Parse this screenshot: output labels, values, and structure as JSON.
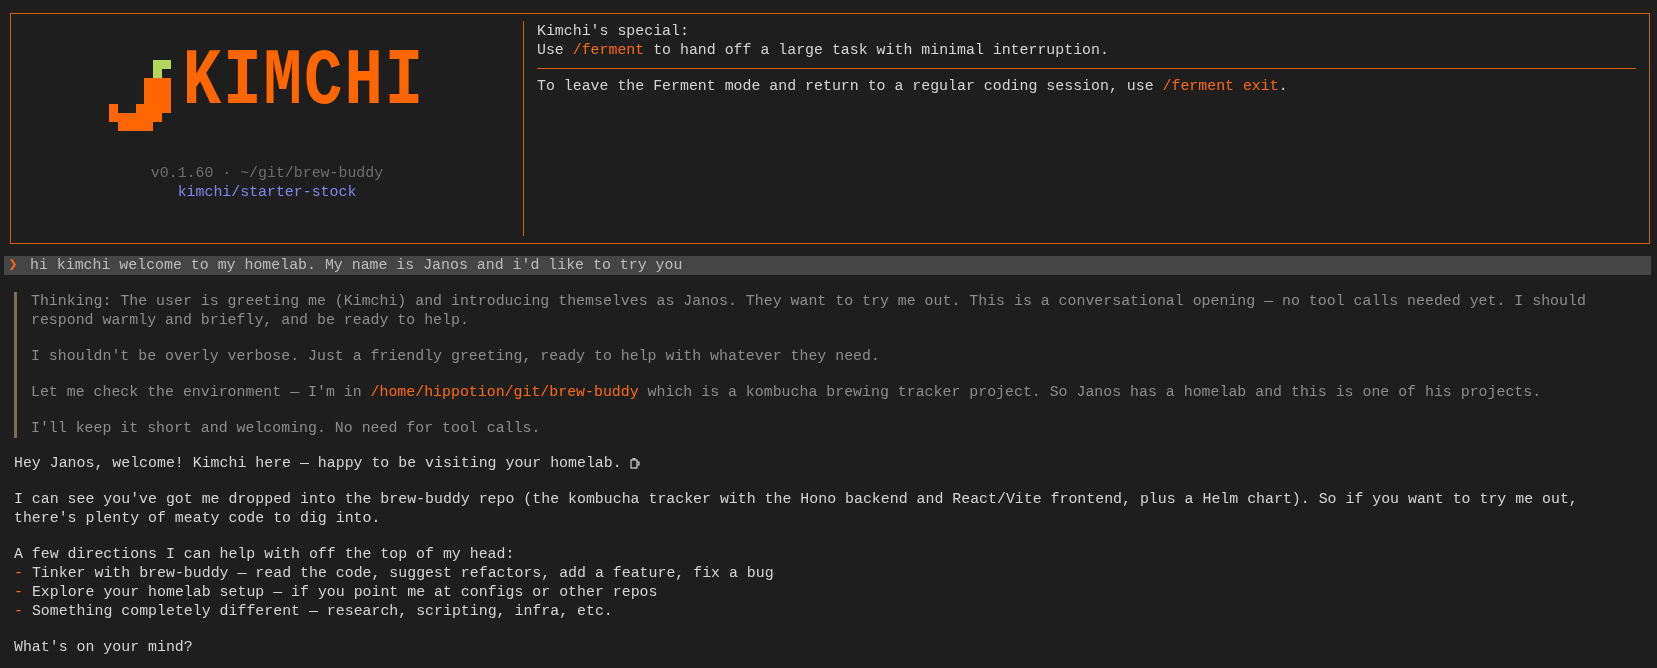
{
  "header": {
    "logo_text": "KIMCHI",
    "version_line": "v0.1.60 · ~/git/brew-buddy",
    "model": "kimchi/starter-stock",
    "special_title": "Kimchi's special:",
    "special_line": [
      {
        "kind": "plain",
        "text": "Use "
      },
      {
        "kind": "command",
        "text": "/ferment"
      },
      {
        "kind": "plain",
        "text": " to hand off a large task with minimal interruption."
      }
    ],
    "exit_line": [
      {
        "kind": "plain",
        "text": "To leave the Ferment mode and return to a regular coding session, use "
      },
      {
        "kind": "command",
        "text": "/ferment exit"
      },
      {
        "kind": "plain",
        "text": "."
      }
    ]
  },
  "prompt": {
    "marker": "❯",
    "text": "hi kimchi welcome to my homelab. My name is Janos and i'd like to try you"
  },
  "thinking": [
    [
      {
        "kind": "plain",
        "text": "Thinking: The user is greeting me (Kimchi) and introducing themselves as Janos. They want to try me out. This is a conversational opening — no tool calls needed yet. I should respond warmly and briefly, and be ready to help."
      }
    ],
    [
      {
        "kind": "plain",
        "text": "I shouldn't be overly verbose. Just a friendly greeting, ready to help with whatever they need."
      }
    ],
    [
      {
        "kind": "plain",
        "text": "Let me check the environment — I'm in "
      },
      {
        "kind": "command",
        "text": "/home/hippotion/git/brew-buddy"
      },
      {
        "kind": "plain",
        "text": " which is a kombucha brewing tracker project. So Janos has a homelab and this is one of his projects."
      }
    ],
    [
      {
        "kind": "plain",
        "text": "I'll keep it short and welcoming. No need for tool calls."
      }
    ]
  ],
  "response": [
    {
      "kind": "paragraph",
      "text": "Hey Janos, welcome! Kimchi here — happy to be visiting your homelab.",
      "mug": true
    },
    {
      "kind": "paragraph",
      "text": "I can see you've got me dropped into the brew-buddy repo (the kombucha tracker with the Hono backend and React/Vite frontend, plus a Helm chart). So if you want to try me out, there's plenty of meaty code to dig into."
    },
    {
      "kind": "list",
      "intro": "A few directions I can help with off the top of my head:",
      "items": [
        {
          "marker": "-",
          "text": "Tinker with brew-buddy — read the code, suggest refactors, add a feature, fix a bug"
        },
        {
          "marker": "-",
          "text": "Explore your homelab setup — if you point me at configs or other repos"
        },
        {
          "marker": "-",
          "text": "Something completely different — research, scripting, infra, etc."
        }
      ]
    },
    {
      "kind": "paragraph",
      "text": "What's on your mind?"
    }
  ]
}
